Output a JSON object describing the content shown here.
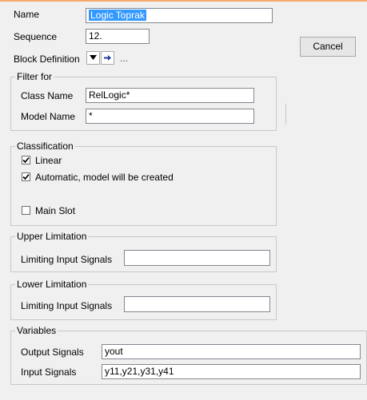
{
  "header": {
    "name_label": "Name",
    "name_value": "Logic Toprak",
    "sequence_label": "Sequence",
    "sequence_value": "12.",
    "block_definition_label": "Block Definition",
    "block_definition_ellipsis": "..."
  },
  "buttons": {
    "cancel_label": "Cancel"
  },
  "filter": {
    "title": "Filter for",
    "class_name_label": "Class Name",
    "class_name_value": "RelLogic*",
    "model_name_label": "Model Name",
    "model_name_value": "*"
  },
  "classification": {
    "title": "Classification",
    "linear_label": "Linear",
    "linear_checked": true,
    "automatic_label": "Automatic, model will be created",
    "automatic_checked": true,
    "main_slot_label": "Main Slot",
    "main_slot_checked": false
  },
  "upper_limitation": {
    "title": "Upper Limitation",
    "limiting_label": "Limiting Input Signals",
    "limiting_value": ""
  },
  "lower_limitation": {
    "title": "Lower Limitation",
    "limiting_label": "Limiting Input Signals",
    "limiting_value": ""
  },
  "variables": {
    "title": "Variables",
    "output_label": "Output Signals",
    "output_value": "yout",
    "input_label": "Input Signals",
    "input_value": "y11,y21,y31,y41"
  },
  "colors": {
    "selection": "#3399ff",
    "top_accent": "#f6a96b",
    "dialog_bg": "#f0f0f0"
  }
}
